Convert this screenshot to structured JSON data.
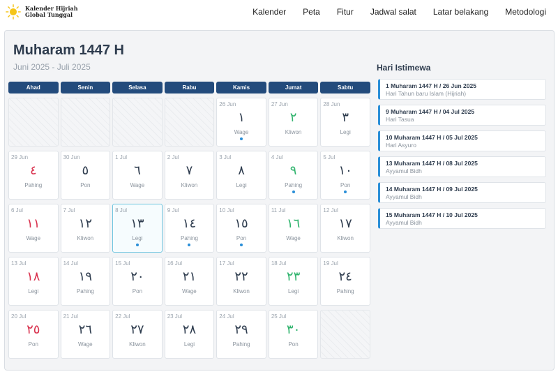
{
  "header": {
    "logo_line1": "Kalender Hijriah",
    "logo_line2": "Global Tunggal",
    "nav": [
      "Kalender",
      "Peta",
      "Fitur",
      "Jadwal salat",
      "Latar belakang",
      "Metodologi"
    ]
  },
  "calendar": {
    "title": "Muharam 1447 H",
    "subtitle": "Juni 2025 - Juli 2025",
    "weekdays": [
      "Ahad",
      "Senin",
      "Selasa",
      "Rabu",
      "Kamis",
      "Jumat",
      "Sabtu"
    ],
    "cells": [
      {
        "empty": true
      },
      {
        "empty": true
      },
      {
        "empty": true
      },
      {
        "empty": true
      },
      {
        "greg": "26 Jun",
        "hijri": "١",
        "pasaran": "Wage",
        "dot": true,
        "color": "normal"
      },
      {
        "greg": "27 Jun",
        "hijri": "٢",
        "pasaran": "Kliwon",
        "dot": false,
        "color": "green"
      },
      {
        "greg": "28 Jun",
        "hijri": "٣",
        "pasaran": "Legi",
        "dot": false,
        "color": "normal"
      },
      {
        "greg": "29 Jun",
        "hijri": "٤",
        "pasaran": "Pahing",
        "dot": false,
        "color": "red"
      },
      {
        "greg": "30 Jun",
        "hijri": "٥",
        "pasaran": "Pon",
        "dot": false,
        "color": "normal"
      },
      {
        "greg": "1 Jul",
        "hijri": "٦",
        "pasaran": "Wage",
        "dot": false,
        "color": "normal"
      },
      {
        "greg": "2 Jul",
        "hijri": "٧",
        "pasaran": "Kliwon",
        "dot": false,
        "color": "normal"
      },
      {
        "greg": "3 Jul",
        "hijri": "٨",
        "pasaran": "Legi",
        "dot": false,
        "color": "normal"
      },
      {
        "greg": "4 Jul",
        "hijri": "٩",
        "pasaran": "Pahing",
        "dot": true,
        "color": "green"
      },
      {
        "greg": "5 Jul",
        "hijri": "١٠",
        "pasaran": "Pon",
        "dot": true,
        "color": "normal"
      },
      {
        "greg": "6 Jul",
        "hijri": "١١",
        "pasaran": "Wage",
        "dot": false,
        "color": "red"
      },
      {
        "greg": "7 Jul",
        "hijri": "١٢",
        "pasaran": "Kliwon",
        "dot": false,
        "color": "normal"
      },
      {
        "greg": "8 Jul",
        "hijri": "١٣",
        "pasaran": "Legi",
        "dot": true,
        "color": "normal",
        "today": true
      },
      {
        "greg": "9 Jul",
        "hijri": "١٤",
        "pasaran": "Pahing",
        "dot": true,
        "color": "normal"
      },
      {
        "greg": "10 Jul",
        "hijri": "١٥",
        "pasaran": "Pon",
        "dot": true,
        "color": "normal"
      },
      {
        "greg": "11 Jul",
        "hijri": "١٦",
        "pasaran": "Wage",
        "dot": false,
        "color": "green"
      },
      {
        "greg": "12 Jul",
        "hijri": "١٧",
        "pasaran": "Kliwon",
        "dot": false,
        "color": "normal"
      },
      {
        "greg": "13 Jul",
        "hijri": "١٨",
        "pasaran": "Legi",
        "dot": false,
        "color": "red"
      },
      {
        "greg": "14 Jul",
        "hijri": "١٩",
        "pasaran": "Pahing",
        "dot": false,
        "color": "normal"
      },
      {
        "greg": "15 Jul",
        "hijri": "٢٠",
        "pasaran": "Pon",
        "dot": false,
        "color": "normal"
      },
      {
        "greg": "16 Jul",
        "hijri": "٢١",
        "pasaran": "Wage",
        "dot": false,
        "color": "normal"
      },
      {
        "greg": "17 Jul",
        "hijri": "٢٢",
        "pasaran": "Kliwon",
        "dot": false,
        "color": "normal"
      },
      {
        "greg": "18 Jul",
        "hijri": "٢٣",
        "pasaran": "Legi",
        "dot": false,
        "color": "green"
      },
      {
        "greg": "19 Jul",
        "hijri": "٢٤",
        "pasaran": "Pahing",
        "dot": false,
        "color": "normal"
      },
      {
        "greg": "20 Jul",
        "hijri": "٢٥",
        "pasaran": "Pon",
        "dot": false,
        "color": "red"
      },
      {
        "greg": "21 Jul",
        "hijri": "٢٦",
        "pasaran": "Wage",
        "dot": false,
        "color": "normal"
      },
      {
        "greg": "22 Jul",
        "hijri": "٢٧",
        "pasaran": "Kliwon",
        "dot": false,
        "color": "normal"
      },
      {
        "greg": "23 Jul",
        "hijri": "٢٨",
        "pasaran": "Legi",
        "dot": false,
        "color": "normal"
      },
      {
        "greg": "24 Jul",
        "hijri": "٢٩",
        "pasaran": "Pahing",
        "dot": false,
        "color": "normal"
      },
      {
        "greg": "25 Jul",
        "hijri": "٣٠",
        "pasaran": "Pon",
        "dot": false,
        "color": "green"
      },
      {
        "empty": true
      }
    ]
  },
  "special_days": {
    "title": "Hari Istimewa",
    "items": [
      {
        "date": "1 Muharam 1447 H / 26 Jun 2025",
        "desc": "Hari Tahun baru Islam (Hijriah)"
      },
      {
        "date": "9 Muharam 1447 H / 04 Jul 2025",
        "desc": "Hari Tasua"
      },
      {
        "date": "10 Muharam 1447 H / 05 Jul 2025",
        "desc": "Hari Asyuro"
      },
      {
        "date": "13 Muharam 1447 H / 08 Jul 2025",
        "desc": "Ayyamul Bidh"
      },
      {
        "date": "14 Muharam 1447 H / 09 Jul 2025",
        "desc": "Ayyamul Bidh"
      },
      {
        "date": "15 Muharam 1447 H / 10 Jul 2025",
        "desc": "Ayyamul Bidh"
      }
    ]
  },
  "colors": {
    "weekday_bg": "#234b7c",
    "accent": "#2a8fd8",
    "red": "#d9324e",
    "green": "#2eb36c",
    "today_border": "#6fc5df",
    "logo_sun": "#f5c518"
  },
  "icons": {
    "logo": "sun-icon"
  }
}
